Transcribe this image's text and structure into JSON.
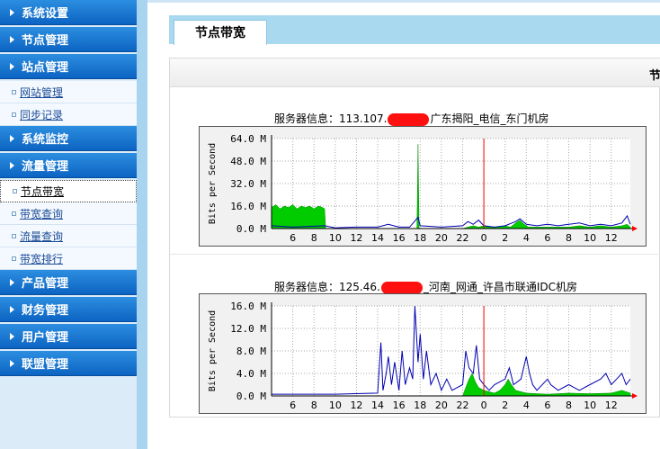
{
  "sidebar": {
    "sections": [
      {
        "label": "系统设置",
        "items": []
      },
      {
        "label": "节点管理",
        "items": []
      },
      {
        "label": "站点管理",
        "items": [
          {
            "label": "网站管理"
          },
          {
            "label": "同步记录"
          }
        ]
      },
      {
        "label": "系统监控",
        "items": []
      },
      {
        "label": "流量管理",
        "items": [
          {
            "label": "节点带宽",
            "active": true
          },
          {
            "label": "带宽查询"
          },
          {
            "label": "流量查询"
          },
          {
            "label": "带宽排行"
          }
        ]
      },
      {
        "label": "产品管理",
        "items": []
      },
      {
        "label": "财务管理",
        "items": []
      },
      {
        "label": "用户管理",
        "items": []
      },
      {
        "label": "联盟管理",
        "items": []
      }
    ]
  },
  "main": {
    "tab_title": "节点带宽",
    "panel_header_text": "节"
  },
  "servers": [
    {
      "prefix": "服务器信息：113.107.",
      "suffix": "广东揭阳_电信_东门机房"
    },
    {
      "prefix": "服务器信息：125.46.",
      "suffix": "_河南_网通_许昌市联通IDC机房"
    }
  ],
  "colors": {
    "sidebar_section": "#1478d4",
    "inbound_fill": "#00cc00",
    "outbound_line": "#0000b0",
    "now_marker": "#ff0000"
  },
  "chart_data": [
    {
      "type": "area",
      "ylabel": "Bits per Second",
      "ylim": [
        0,
        64
      ],
      "y_ticks": [
        "64.0 M",
        "48.0 M",
        "32.0 M",
        "16.0 M",
        "0.0 M"
      ],
      "x_tick_labels": [
        "6",
        "8",
        "10",
        "12",
        "14",
        "16",
        "18",
        "20",
        "22",
        "0",
        "2",
        "4",
        "6",
        "8",
        "10",
        "12"
      ],
      "grid": true,
      "now_marker_hour": 0,
      "series": [
        {
          "values": [
            [
              4.0,
              15
            ],
            [
              4.4,
              17
            ],
            [
              4.8,
              14
            ],
            [
              5.2,
              16
            ],
            [
              5.6,
              15
            ],
            [
              6.0,
              17
            ],
            [
              6.4,
              14
            ],
            [
              6.8,
              16
            ],
            [
              7.2,
              15
            ],
            [
              7.6,
              16
            ],
            [
              8.0,
              14
            ],
            [
              8.4,
              16
            ],
            [
              8.8,
              15
            ],
            [
              9.0,
              14
            ],
            [
              9.1,
              0
            ],
            [
              17.7,
              0
            ],
            [
              17.8,
              60
            ],
            [
              17.9,
              0
            ],
            [
              22.0,
              0
            ],
            [
              22.5,
              1
            ],
            [
              23.0,
              2
            ],
            [
              23.5,
              1
            ],
            [
              24.0,
              2
            ],
            [
              25.0,
              1
            ],
            [
              26.0,
              2
            ],
            [
              26.5,
              1
            ],
            [
              27.0,
              4
            ],
            [
              27.4,
              6
            ],
            [
              27.8,
              3
            ],
            [
              28.2,
              1
            ],
            [
              29.0,
              1
            ],
            [
              30.0,
              1
            ],
            [
              31.0,
              1
            ],
            [
              32.0,
              1
            ],
            [
              33.0,
              2
            ],
            [
              34.0,
              1
            ],
            [
              35.0,
              2
            ],
            [
              36.0,
              1
            ],
            [
              37.0,
              2
            ],
            [
              37.5,
              3
            ],
            [
              37.8,
              1
            ]
          ]
        },
        {
          "values": [
            [
              4.0,
              2
            ],
            [
              6.0,
              1
            ],
            [
              9.0,
              2
            ],
            [
              10.0,
              0.5
            ],
            [
              12.0,
              1
            ],
            [
              14.0,
              1
            ],
            [
              15.0,
              3
            ],
            [
              15.5,
              2
            ],
            [
              16.0,
              1
            ],
            [
              17.0,
              1
            ],
            [
              17.8,
              8
            ],
            [
              18.0,
              2
            ],
            [
              20.0,
              1
            ],
            [
              22.0,
              2
            ],
            [
              22.5,
              5
            ],
            [
              23.0,
              3
            ],
            [
              23.5,
              6
            ],
            [
              24.0,
              2
            ],
            [
              25.0,
              1
            ],
            [
              26.0,
              2
            ],
            [
              27.0,
              5
            ],
            [
              27.4,
              7
            ],
            [
              28.0,
              3
            ],
            [
              29.0,
              2
            ],
            [
              30.0,
              3
            ],
            [
              31.0,
              2
            ],
            [
              32.0,
              3
            ],
            [
              33.0,
              4
            ],
            [
              34.0,
              2
            ],
            [
              35.0,
              3
            ],
            [
              36.0,
              2
            ],
            [
              37.0,
              4
            ],
            [
              37.5,
              9
            ],
            [
              37.8,
              3
            ]
          ]
        }
      ]
    },
    {
      "type": "area",
      "ylabel": "Bits per Second",
      "ylim": [
        0,
        16
      ],
      "y_ticks": [
        "16.0 M",
        "12.0 M",
        "8.0 M",
        "4.0 M",
        "0.0 M"
      ],
      "x_tick_labels": [
        "6",
        "8",
        "10",
        "12",
        "14",
        "16",
        "18",
        "20",
        "22",
        "0",
        "2",
        "4",
        "6",
        "8",
        "10",
        "12"
      ],
      "grid": true,
      "now_marker_hour": 0,
      "series": [
        {
          "values": [
            [
              4.0,
              0
            ],
            [
              22.0,
              0
            ],
            [
              22.3,
              1.5
            ],
            [
              22.6,
              3
            ],
            [
              22.9,
              4
            ],
            [
              23.2,
              2.5
            ],
            [
              23.5,
              1.5
            ],
            [
              24.0,
              1
            ],
            [
              25.0,
              0.5
            ],
            [
              25.5,
              1
            ],
            [
              26.0,
              2
            ],
            [
              26.3,
              3
            ],
            [
              26.6,
              2
            ],
            [
              27.0,
              1
            ],
            [
              28.0,
              0.5
            ],
            [
              30.0,
              0.3
            ],
            [
              32.0,
              0.5
            ],
            [
              34.0,
              0.4
            ],
            [
              36.0,
              0.5
            ],
            [
              37.0,
              1
            ],
            [
              37.8,
              0.5
            ]
          ]
        },
        {
          "values": [
            [
              4.0,
              0.3
            ],
            [
              10.0,
              0.3
            ],
            [
              14.0,
              0.5
            ],
            [
              14.3,
              9.5
            ],
            [
              14.5,
              1
            ],
            [
              14.8,
              4
            ],
            [
              15.0,
              7
            ],
            [
              15.3,
              2
            ],
            [
              15.6,
              6
            ],
            [
              16.0,
              1
            ],
            [
              16.3,
              8
            ],
            [
              16.6,
              2
            ],
            [
              17.0,
              5
            ],
            [
              17.3,
              3
            ],
            [
              17.5,
              16
            ],
            [
              17.8,
              6
            ],
            [
              18.0,
              11
            ],
            [
              18.3,
              3
            ],
            [
              18.6,
              8
            ],
            [
              19.0,
              2
            ],
            [
              19.5,
              4
            ],
            [
              20.0,
              1
            ],
            [
              20.5,
              3
            ],
            [
              21.0,
              1
            ],
            [
              22.0,
              2
            ],
            [
              22.3,
              8
            ],
            [
              22.6,
              5
            ],
            [
              23.0,
              4
            ],
            [
              23.3,
              9
            ],
            [
              23.6,
              3
            ],
            [
              24.0,
              2
            ],
            [
              24.5,
              1
            ],
            [
              25.0,
              2
            ],
            [
              26.0,
              3
            ],
            [
              26.4,
              5
            ],
            [
              26.8,
              2
            ],
            [
              27.5,
              3
            ],
            [
              28.0,
              7
            ],
            [
              28.3,
              4
            ],
            [
              28.6,
              2
            ],
            [
              29.0,
              1
            ],
            [
              30.0,
              3
            ],
            [
              30.3,
              2
            ],
            [
              31.0,
              1
            ],
            [
              32.0,
              2
            ],
            [
              33.0,
              1
            ],
            [
              34.0,
              2
            ],
            [
              35.0,
              3
            ],
            [
              35.5,
              4
            ],
            [
              36.0,
              2
            ],
            [
              36.5,
              3
            ],
            [
              37.0,
              4
            ],
            [
              37.4,
              2
            ],
            [
              37.8,
              3
            ]
          ]
        }
      ]
    }
  ]
}
